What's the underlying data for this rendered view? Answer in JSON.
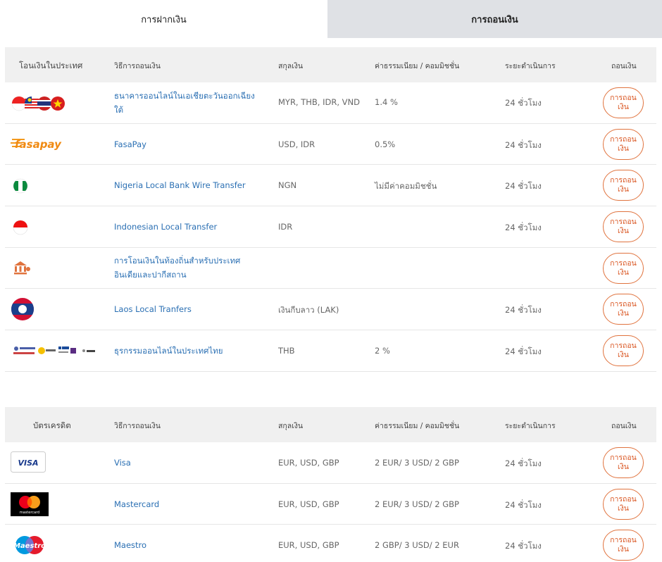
{
  "tabs": {
    "deposit": "การฝากเงิน",
    "withdraw": "การถอนเงิน"
  },
  "section1": {
    "headers": {
      "category": "โอนเงินในประเทศ",
      "method": "วิธีการถอนเงิน",
      "currency": "สกุลเงิน",
      "fee": "ค่าธรรมเนียม / คอมมิชชั่น",
      "time": "ระยะดำเนินการ",
      "action": "ถอนเงิน"
    },
    "rows": [
      {
        "logo": "sea-flags-icon",
        "method": "ธนาคารออนไลน์ในเอเชียตะวันออกเฉียงใต้",
        "currency": "MYR, THB, IDR, VND",
        "fee": "1.4 %",
        "time": "24 ชั่วโมง",
        "button": "การถอนเงิน"
      },
      {
        "logo": "fasapay-logo",
        "logo_text": "fasapay",
        "method": "FasaPay",
        "currency": "USD, IDR",
        "fee": "0.5%",
        "time": "24 ชั่วโมง",
        "button": "การถอนเงิน"
      },
      {
        "logo": "nigeria-flag-icon",
        "method": "Nigeria Local Bank Wire Transfer",
        "currency": "NGN",
        "fee": "ไม่มีค่าคอมมิชชั่น",
        "time": "24 ชั่วโมง",
        "button": "การถอนเงิน"
      },
      {
        "logo": "indonesia-flag-icon",
        "method": "Indonesian Local Transfer",
        "currency": "IDR",
        "fee": "",
        "time": "24 ชั่วโมง",
        "button": "การถอนเงิน"
      },
      {
        "logo": "bank-icon",
        "method": "การโอนเงินในท้องถิ่นสำหรับประเทศอินเดียและปากีสถาน",
        "currency": "",
        "fee": "",
        "time": "",
        "button": "การถอนเงิน"
      },
      {
        "logo": "laos-flag-icon",
        "method": "Laos Local Tranfers",
        "currency": "เงินกีบลาว (LAK)",
        "fee": "",
        "time": "24 ชั่วโมง",
        "button": "การถอนเงิน"
      },
      {
        "logo": "thai-banks-logos",
        "method": "ธุรกรรมออนไลน์ในประเทศไทย",
        "currency": "THB",
        "fee": "2 %",
        "time": "24 ชั่วโมง",
        "button": "การถอนเงิน"
      }
    ]
  },
  "section2": {
    "headers": {
      "category": "บัตรเครดิต",
      "method": "วิธีการถอนเงิน",
      "currency": "สกุลเงิน",
      "fee": "ค่าธรรมเนียม / คอมมิชชั่น",
      "time": "ระยะดำเนินการ",
      "action": "ถอนเงิน"
    },
    "rows": [
      {
        "logo": "visa-logo",
        "logo_text": "VISA",
        "method": "Visa",
        "currency": "EUR, USD, GBP",
        "fee": "2 EUR/ 3 USD/ 2 GBP",
        "time": "24 ชั่วโมง",
        "button": "การถอนเงิน"
      },
      {
        "logo": "mastercard-logo",
        "logo_text": "mastercard",
        "method": "Mastercard",
        "currency": "EUR, USD, GBP",
        "fee": "2 EUR/ 3 USD/ 2 GBP",
        "time": "24 ชั่วโมง",
        "button": "การถอนเงิน"
      },
      {
        "logo": "maestro-logo",
        "logo_text": "Maestro",
        "method": "Maestro",
        "currency": "EUR, USD, GBP",
        "fee": "2 GBP/ 3 USD/ 2 EUR",
        "time": "24 ชั่วโมง",
        "button": "การถอนเงิน"
      }
    ]
  },
  "colors": {
    "accent": "#e0733e",
    "link": "#2a6fb3",
    "header_bg": "#f0f0f0",
    "active_tab_bg": "#dfe1e5"
  }
}
